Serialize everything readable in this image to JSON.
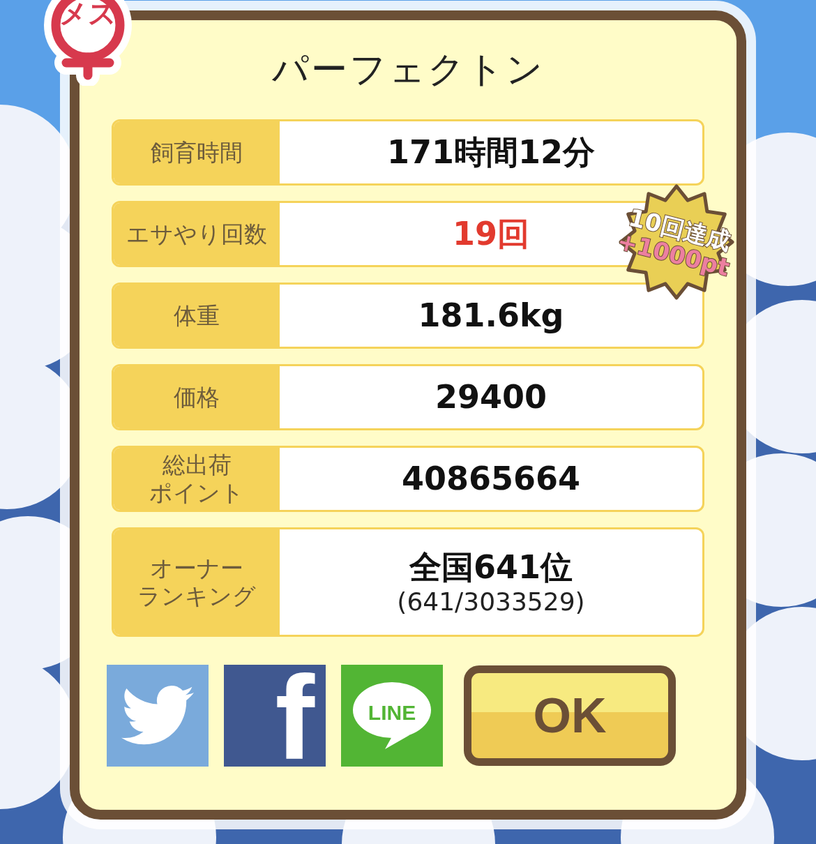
{
  "gender_badge": {
    "label": "メス"
  },
  "title": "パーフェクトン",
  "stats": [
    {
      "label": "飼育時間",
      "value": "171時間12分",
      "highlight": false
    },
    {
      "label": "エサやり回数",
      "value": "19回",
      "highlight": true
    },
    {
      "label": "体重",
      "value": "181.6kg",
      "highlight": false
    },
    {
      "label": "価格",
      "value": "29400",
      "highlight": false
    },
    {
      "label_lines": [
        "総出荷",
        "ポイント"
      ],
      "value": "40865664",
      "highlight": false
    }
  ],
  "ranking": {
    "label_lines": [
      "オーナー",
      "ランキング"
    ],
    "value": "全国641位",
    "detail": "(641/3033529)"
  },
  "achievement_badge": {
    "line1": "10回達成",
    "line2": "+1000pt"
  },
  "share_buttons": [
    {
      "kind": "twitter"
    },
    {
      "kind": "facebook",
      "label": "f"
    },
    {
      "kind": "line",
      "label": "LINE"
    }
  ],
  "ok_button": {
    "label": "OK"
  }
}
